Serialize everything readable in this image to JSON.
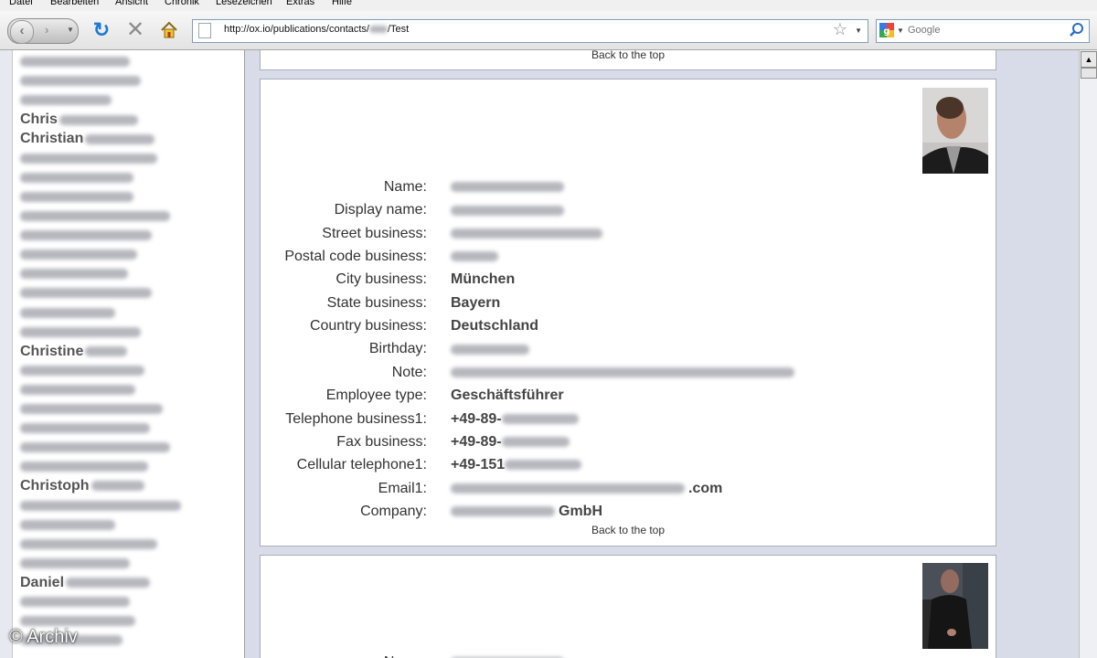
{
  "menu": [
    "Datei",
    "Bearbeiten",
    "Ansicht",
    "Chronik",
    "Lesezeichen",
    "Extras",
    "Hilfe"
  ],
  "toolbar": {
    "url": "http://ox.io/publications/contacts/",
    "url_tail": "/Test",
    "search_placeholder": "Google"
  },
  "sidebar": {
    "items": [
      {
        "text": "",
        "blur": 120
      },
      {
        "text": "",
        "blur": 132
      },
      {
        "text": "",
        "blur": 100
      },
      {
        "text": "Chris",
        "blur": 86
      },
      {
        "text": "Christian",
        "blur": 76
      },
      {
        "text": "",
        "blur": 150
      },
      {
        "text": "",
        "blur": 124
      },
      {
        "text": "",
        "blur": 124
      },
      {
        "text": "",
        "blur": 164
      },
      {
        "text": "",
        "blur": 144
      },
      {
        "text": "",
        "blur": 128
      },
      {
        "text": "",
        "blur": 118
      },
      {
        "text": "",
        "blur": 144
      },
      {
        "text": "",
        "blur": 104
      },
      {
        "text": "",
        "blur": 132
      },
      {
        "text": "Christine",
        "blur": 46
      },
      {
        "text": "",
        "blur": 136
      },
      {
        "text": "",
        "blur": 126
      },
      {
        "text": "",
        "blur": 156
      },
      {
        "text": "",
        "blur": 142
      },
      {
        "text": "",
        "blur": 164
      },
      {
        "text": "",
        "blur": 140
      },
      {
        "text": "Christoph",
        "blur": 58
      },
      {
        "text": "",
        "blur": 176
      },
      {
        "text": "",
        "blur": 104
      },
      {
        "text": "",
        "blur": 150
      },
      {
        "text": "",
        "blur": 120
      },
      {
        "text": "Daniel",
        "blur": 92
      },
      {
        "text": "",
        "blur": 120
      },
      {
        "text": "",
        "blur": 126
      },
      {
        "text": "",
        "blur": 112
      }
    ]
  },
  "contact": {
    "back_to_top": "Back to the top",
    "fields": [
      {
        "label": "Name:",
        "value": "",
        "blur": 124
      },
      {
        "label": "Display name:",
        "value": "",
        "blur": 124
      },
      {
        "label": "Street business:",
        "value": "",
        "blur": 166
      },
      {
        "label": "Postal code business:",
        "value": "",
        "blur": 52
      },
      {
        "label": "City business:",
        "value": "München",
        "blur": 0
      },
      {
        "label": "State business:",
        "value": "Bayern",
        "blur": 0
      },
      {
        "label": "Country business:",
        "value": "Deutschland",
        "blur": 0
      },
      {
        "label": "Birthday:",
        "value": "",
        "blur": 86
      },
      {
        "label": "Note:",
        "value": "",
        "blur": 376
      },
      {
        "label": "Employee type:",
        "value": "Geschäftsführer",
        "blur": 0
      },
      {
        "label": "Telephone business1:",
        "value": "+49-89-",
        "blur": 84,
        "after": true
      },
      {
        "label": "Fax business:",
        "value": "+49-89-",
        "blur": 74,
        "after": true
      },
      {
        "label": "Cellular telephone1:",
        "value": "+49-151",
        "blur": 84,
        "after": true
      },
      {
        "label": "Email1:",
        "value": ".com",
        "blur": 256,
        "after": false
      },
      {
        "label": "Company:",
        "value": "GmbH",
        "blur": 114,
        "after": false
      }
    ]
  },
  "watermark": "© Archiv"
}
